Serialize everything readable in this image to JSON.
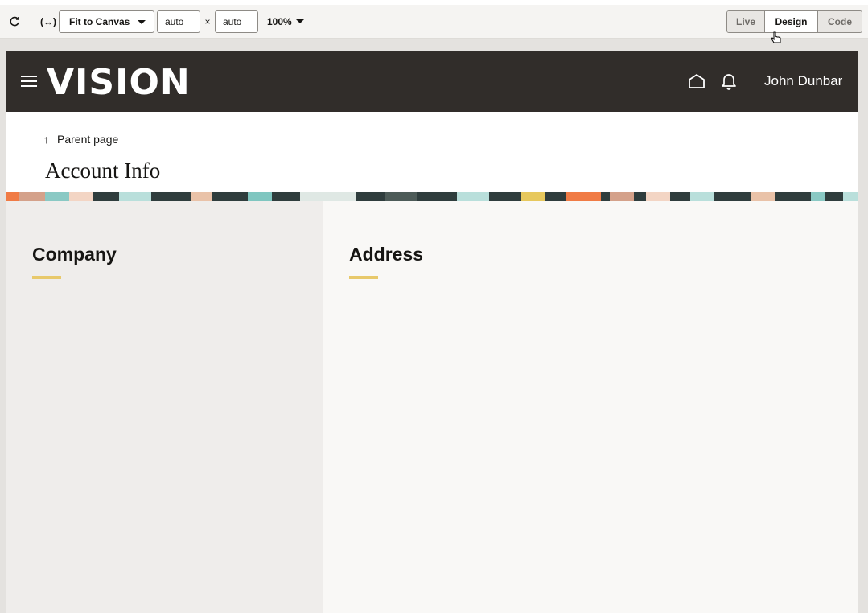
{
  "toolbar": {
    "refresh_icon": "refresh-icon",
    "bindings_label": "(↔)",
    "fit_label": "Fit to Canvas",
    "width_value": "auto",
    "times": "×",
    "height_value": "auto",
    "zoom_label": "100%",
    "modes": {
      "live": "Live",
      "design": "Design",
      "code": "Code"
    },
    "active_mode": "Design"
  },
  "app": {
    "logo": "VISION",
    "user_name": "John Dunbar",
    "header_bg": "#312d2a",
    "icons": [
      "hamburger-icon",
      "home-icon",
      "bell-icon"
    ]
  },
  "page": {
    "breadcrumb": "Parent page",
    "title": "Account Info"
  },
  "sections": {
    "company": "Company",
    "address": "Address",
    "accent": "#e8c96b"
  }
}
